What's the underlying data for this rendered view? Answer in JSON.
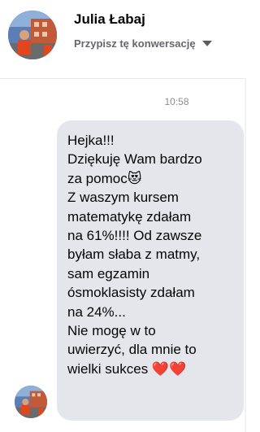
{
  "header": {
    "contact_name": "Julia Łabaj",
    "pin_label": "Przypisz tę konwersację",
    "pin_icon": "chevron-down-icon"
  },
  "conversation": {
    "timestamp": "10:58",
    "message": {
      "text": "Hejka!!!\nDziękuję Wam bardzo\nza pomoc😻\nZ waszym kursem\nmatematykę zdałam\nna 61%!!!! Od zawsze\nbyłam słaba z matmy,\nsam egzamin\nósmoklasisty zdałam\nna 24%...\nNie mogę w to\nuwierzyć, dla mnie to\nwielki sukces ❤️❤️"
    }
  },
  "colors": {
    "bubble_bg": "#e4e6eb",
    "text": "#050505",
    "muted_text": "#65676b",
    "timestamp": "#8a8d91"
  }
}
